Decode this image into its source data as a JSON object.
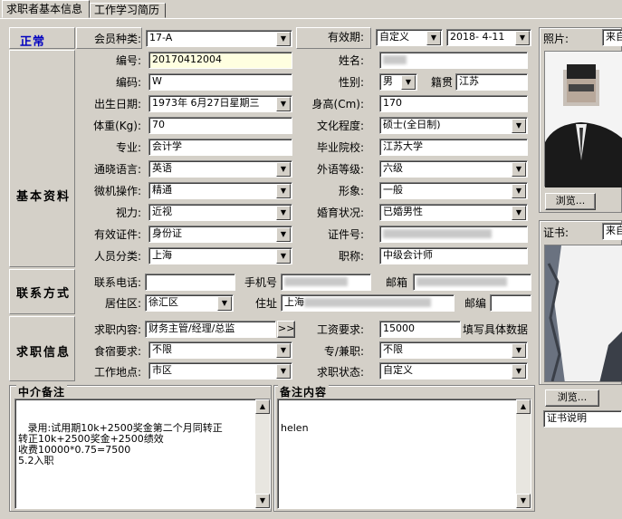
{
  "tabs": [
    "求职者基本信息",
    "工作学习简历"
  ],
  "status": "正常",
  "sections": {
    "basic": "基本资料",
    "contact": "联系方式",
    "job": "求职信息"
  },
  "fields": {
    "member_type": {
      "label": "会员种类:",
      "value": "17-A"
    },
    "validity": {
      "label": "有效期:",
      "mode": "自定义",
      "date": "2018- 4-11"
    },
    "number": {
      "label": "编号:",
      "value": "20170412004"
    },
    "name": {
      "label": "姓名:",
      "value": ""
    },
    "code": {
      "label": "编码:",
      "value": "W"
    },
    "gender": {
      "label": "性别:",
      "value": "男"
    },
    "native": {
      "label": "籍贯",
      "value": "江苏"
    },
    "birth": {
      "label": "出生日期:",
      "value": "1973年 6月27日星期三"
    },
    "height": {
      "label": "身高(Cm):",
      "value": "170"
    },
    "weight": {
      "label": "体重(Kg):",
      "value": "70"
    },
    "education": {
      "label": "文化程度:",
      "value": "硕士(全日制)"
    },
    "major": {
      "label": "专业:",
      "value": "会计学"
    },
    "school": {
      "label": "毕业院校:",
      "value": "江苏大学"
    },
    "language": {
      "label": "通晓语言:",
      "value": "英语"
    },
    "lang_level": {
      "label": "外语等级:",
      "value": "六级"
    },
    "computer": {
      "label": "微机操作:",
      "value": "精通"
    },
    "image": {
      "label": "形象:",
      "value": "一般"
    },
    "vision": {
      "label": "视力:",
      "value": "近视"
    },
    "marital": {
      "label": "婚育状况:",
      "value": "已婚男性"
    },
    "id_type": {
      "label": "有效证件:",
      "value": "身份证"
    },
    "id_no": {
      "label": "证件号:",
      "value": ""
    },
    "category": {
      "label": "人员分类:",
      "value": "上海"
    },
    "title": {
      "label": "职称:",
      "value": "中级会计师"
    },
    "phone": {
      "label": "联系电话:",
      "value": ""
    },
    "mobile": {
      "label": "手机号",
      "value": ""
    },
    "email": {
      "label": "邮箱",
      "value": ""
    },
    "district": {
      "label": "居住区:",
      "value": "徐汇区"
    },
    "address": {
      "label": "住址",
      "value": "上海"
    },
    "zip": {
      "label": "邮编",
      "value": ""
    },
    "job_content": {
      "label": "求职内容:",
      "value": "财务主管/经理/总监",
      "more": ">>"
    },
    "salary": {
      "label": "工资要求:",
      "value": "15000",
      "hint": "填写具体数据"
    },
    "meals": {
      "label": "食宿要求:",
      "value": "不限"
    },
    "parttime": {
      "label": "专/兼职:",
      "value": "不限"
    },
    "workplace": {
      "label": "工作地点:",
      "value": "市区"
    },
    "job_status": {
      "label": "求职状态:",
      "value": "自定义"
    }
  },
  "notes": {
    "agency_label": "中介备注",
    "agency_text": "   录用:试用期10k+2500奖金第二个月同转正\n转正10k+2500奖金+2500绩效\n收费10000*0.75=7500\n5.2入职",
    "remark_label": "备注内容",
    "remark_text": "helen"
  },
  "photo": {
    "label": "照片:",
    "source": "来自",
    "browse": "浏览..."
  },
  "cert": {
    "label": "证书:",
    "source": "来自",
    "browse": "浏览...",
    "desc": "证书说明"
  }
}
